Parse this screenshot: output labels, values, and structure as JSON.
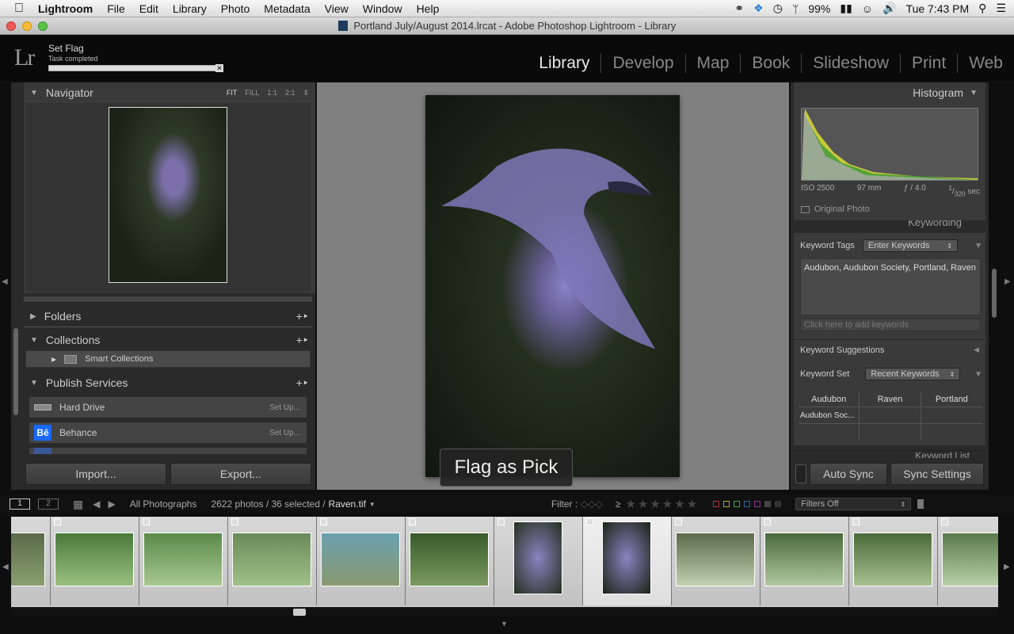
{
  "menubar": {
    "app": "Lightroom",
    "items": [
      "File",
      "Edit",
      "Library",
      "Photo",
      "Metadata",
      "View",
      "Window",
      "Help"
    ],
    "battery": "99%",
    "clock": "Tue 7:43 PM"
  },
  "window": {
    "title": "Portland July/August 2014.lrcat - Adobe Photoshop Lightroom - Library"
  },
  "identity": {
    "logo": "Lr",
    "task_title": "Set Flag",
    "task_status": "Task completed"
  },
  "modules": [
    "Library",
    "Develop",
    "Map",
    "Book",
    "Slideshow",
    "Print",
    "Web"
  ],
  "navigator": {
    "title": "Navigator",
    "zoom": [
      "FIT",
      "FILL",
      "1:1",
      "2:1"
    ]
  },
  "left_panels": {
    "folders": "Folders",
    "collections": "Collections",
    "smart_collections": "Smart Collections",
    "publish": "Publish Services",
    "services": [
      {
        "name": "Hard Drive",
        "action": "Set Up..."
      },
      {
        "name": "Behance",
        "action": "Set Up...",
        "icon": "Bē"
      }
    ],
    "import": "Import...",
    "export": "Export..."
  },
  "loupe": {
    "overlay": "Flag as Pick"
  },
  "histogram": {
    "title": "Histogram",
    "iso": "ISO 2500",
    "focal": "97 mm",
    "aperture": "ƒ / 4.0",
    "shutter_num": "1",
    "shutter_den": "320",
    "shutter_unit": "sec",
    "original_photo": "Original Photo"
  },
  "keywording": {
    "title": "Keywording",
    "tags_label": "Keyword Tags",
    "tags_mode": "Enter Keywords",
    "tags": "Audubon, Audubon Society, Portland, Raven",
    "add_placeholder": "Click here to add keywords",
    "suggestions": "Keyword Suggestions",
    "set_label": "Keyword Set",
    "set_value": "Recent Keywords",
    "set_grid": [
      "Audubon",
      "Raven",
      "Portland",
      "Audubon Soc...",
      "",
      "",
      "",
      "",
      ""
    ],
    "list": "Keyword List"
  },
  "sync": {
    "auto": "Auto Sync",
    "sync": "Sync Settings"
  },
  "filmstrip_bar": {
    "screen1": "1",
    "screen2": "2",
    "source": "All Photographs",
    "count": "2622 photos / 36 selected /",
    "filename": "Raven.tif",
    "filter_label": "Filter :",
    "filters": "Filters Off"
  },
  "colors": {
    "accent_bg": "#0e0e0e",
    "panel": "#3b3b3b",
    "loupe_bg": "#808080",
    "behance": "#1769ff"
  }
}
